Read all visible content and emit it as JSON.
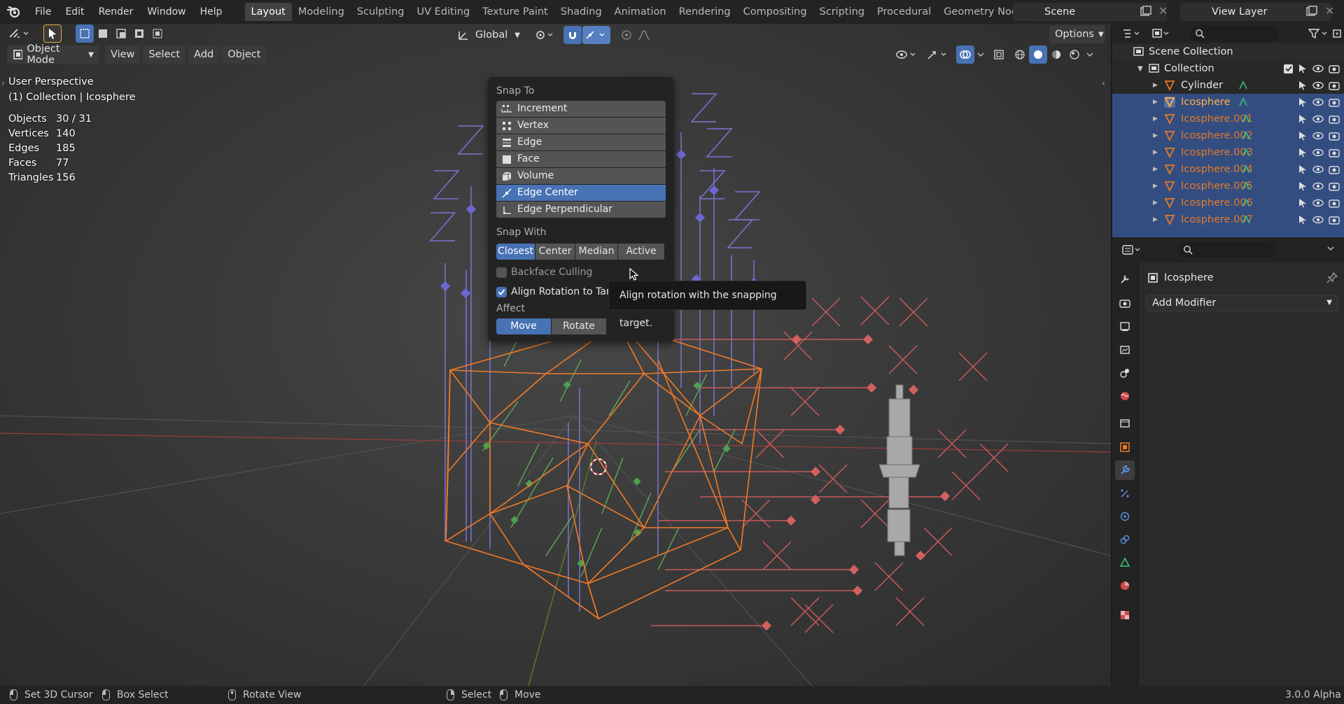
{
  "menu": [
    "File",
    "Edit",
    "Render",
    "Window",
    "Help"
  ],
  "workspaces": [
    "Layout",
    "Modeling",
    "Sculpting",
    "UV Editing",
    "Texture Paint",
    "Shading",
    "Animation",
    "Rendering",
    "Compositing",
    "Scripting",
    "Procedural",
    "Geometry Nodes"
  ],
  "active_workspace": "Layout",
  "scene_name": "Scene",
  "view_layer_name": "View Layer",
  "viewport": {
    "mode": "Object Mode",
    "menus": [
      "View",
      "Select",
      "Add",
      "Object"
    ],
    "orientation": "Global",
    "options_label": "Options",
    "perspective": "User Perspective",
    "context": "(1) Collection | Icosphere",
    "stats": [
      {
        "label": "Objects",
        "value": "30 / 31"
      },
      {
        "label": "Vertices",
        "value": "140"
      },
      {
        "label": "Edges",
        "value": "185"
      },
      {
        "label": "Faces",
        "value": "77"
      },
      {
        "label": "Triangles",
        "value": "156"
      }
    ]
  },
  "snap_popup": {
    "snap_to_label": "Snap To",
    "snap_to_options": [
      "Increment",
      "Vertex",
      "Edge",
      "Face",
      "Volume",
      "Edge Center",
      "Edge Perpendicular"
    ],
    "snap_to_selected": "Edge Center",
    "snap_with_label": "Snap With",
    "snap_with_options": [
      "Closest",
      "Center",
      "Median",
      "Active"
    ],
    "snap_with_selected": "Closest",
    "backface_culling_label": "Backface Culling",
    "backface_culling": false,
    "align_rotation_label": "Align Rotation to Target",
    "align_rotation": true,
    "affect_label": "Affect",
    "affect_options": [
      "Move",
      "Rotate"
    ],
    "affect_selected": "Move"
  },
  "tooltip": "Align rotation with the snapping target.",
  "outliner": {
    "scene_collection": "Scene Collection",
    "collection": "Collection",
    "items": [
      {
        "name": "Cylinder",
        "selected": false
      },
      {
        "name": "Icosphere",
        "selected": true,
        "active": true
      },
      {
        "name": "Icosphere.001",
        "selected": true
      },
      {
        "name": "Icosphere.002",
        "selected": true
      },
      {
        "name": "Icosphere.003",
        "selected": true
      },
      {
        "name": "Icosphere.004",
        "selected": true
      },
      {
        "name": "Icosphere.005",
        "selected": true
      },
      {
        "name": "Icosphere.006",
        "selected": true
      },
      {
        "name": "Icosphere.007",
        "selected": true
      }
    ]
  },
  "properties": {
    "object_name": "Icosphere",
    "add_modifier": "Add Modifier"
  },
  "statusbar": {
    "items": [
      "Set 3D Cursor",
      "Box Select",
      "Rotate View",
      "Select",
      "Move"
    ],
    "version": "3.0.0 Alpha"
  },
  "colors": {
    "accent": "#4772b3",
    "selected_object": "#e57a2a",
    "active_object": "#ffb14a"
  }
}
